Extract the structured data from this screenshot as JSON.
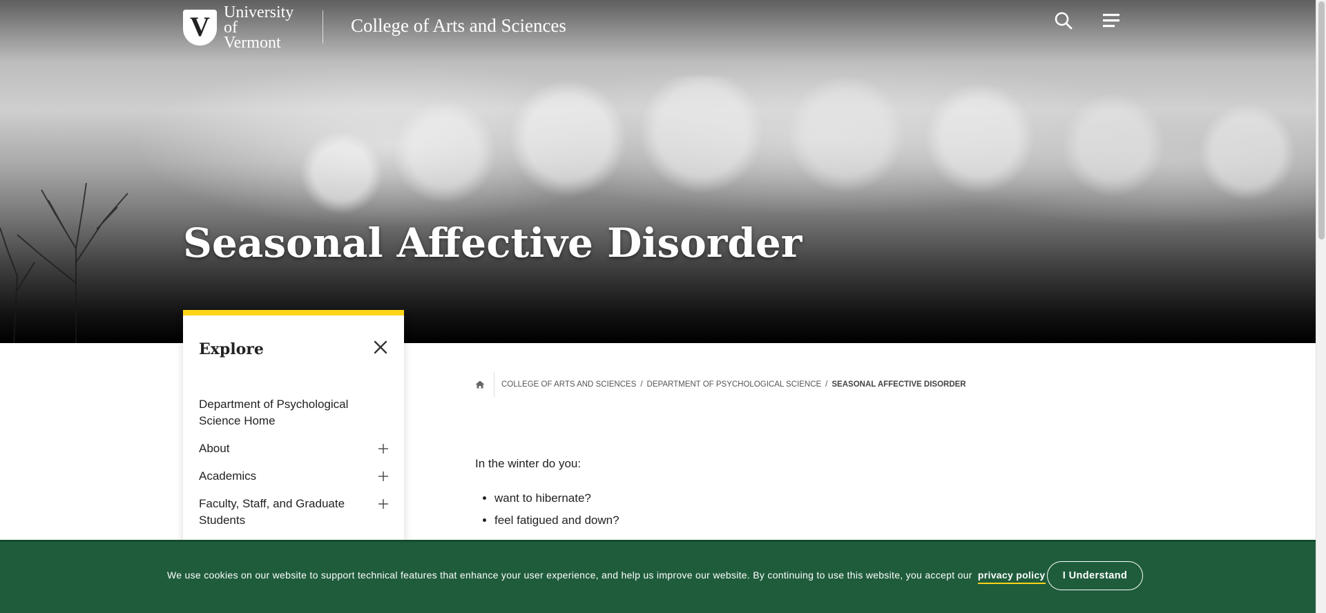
{
  "header": {
    "logo_line1": "University",
    "logo_line2": "of Vermont",
    "logo_letter": "V",
    "college_title": "College of Arts and Sciences",
    "search_icon": "search-icon",
    "menu_icon": "menu-icon"
  },
  "hero": {
    "title": "Seasonal Affective Disorder"
  },
  "sidebar": {
    "title": "Explore",
    "close_icon": "close-icon",
    "items": [
      {
        "label": "Department of Psychological Science Home",
        "expandable": false
      },
      {
        "label": "About",
        "expandable": true
      },
      {
        "label": "Academics",
        "expandable": true
      },
      {
        "label": "Faculty, Staff, and Graduate Students",
        "expandable": true
      }
    ]
  },
  "breadcrumb": {
    "home_icon": "home-icon",
    "items": [
      "COLLEGE OF ARTS AND SCIENCES",
      "DEPARTMENT OF PSYCHOLOGICAL SCIENCE",
      "SEASONAL AFFECTIVE DISORDER"
    ],
    "separator": "/"
  },
  "content": {
    "intro": "In the winter do you:",
    "symptoms": [
      "want to hibernate?",
      "feel fatigued and down?"
    ]
  },
  "cookie": {
    "text": "We use cookies on our website to support technical features that enhance your user experience, and help us improve our website. By continuing to use this website, you accept our",
    "link": "privacy policy",
    "button": "I Understand"
  },
  "colors": {
    "accent_yellow": "#ffd416",
    "cookie_green": "#1f5c3c"
  }
}
